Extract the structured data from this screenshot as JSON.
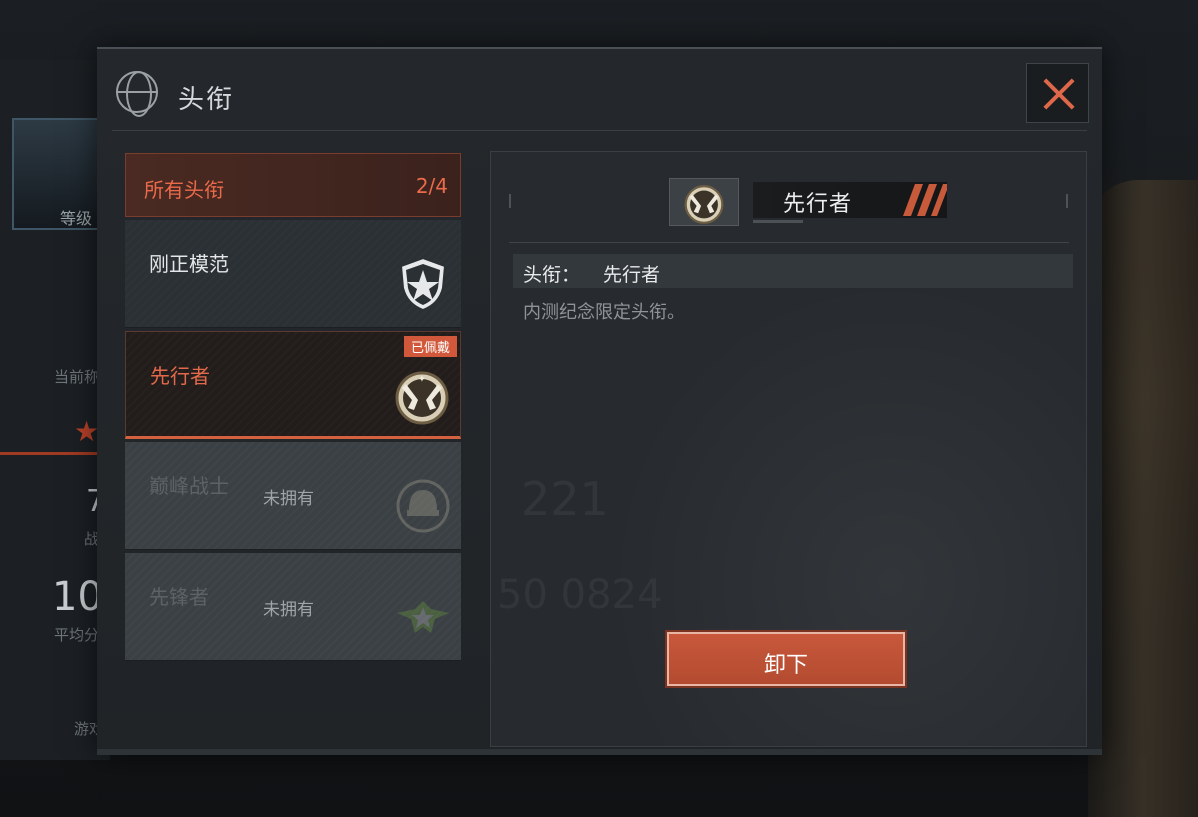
{
  "background": {
    "avatar_level_label": "等级",
    "current_label": "当前称",
    "stat_value_1": "7",
    "stat_label_1": "战",
    "stat_value_2": "10",
    "stat_label_2": "平均分",
    "bottom_label": "游戏",
    "ghost_value_1": "221",
    "ghost_value_2": "50 0824"
  },
  "modal": {
    "title": "头衔",
    "close_icon": "close-icon"
  },
  "list": {
    "all_titles_label": "所有头衔",
    "all_titles_count": "2/4",
    "items": [
      {
        "name": "刚正模范",
        "status": "",
        "icon": "shield-star-icon"
      },
      {
        "name": "先行者",
        "status": "",
        "badge": "已佩戴",
        "icon": "pistols-emblem-icon"
      },
      {
        "name": "巅峰战士",
        "status": "未拥有",
        "icon": "helmet-emblem-icon"
      },
      {
        "name": "先锋者",
        "status": "未拥有",
        "icon": "winged-star-icon"
      }
    ]
  },
  "detail": {
    "name": "先行者",
    "label": "头衔：",
    "value": "先行者",
    "description": "内测纪念限定头衔。",
    "unequip_label": "卸下"
  },
  "colors": {
    "accent": "#e3694a",
    "button": "#c8583b"
  }
}
